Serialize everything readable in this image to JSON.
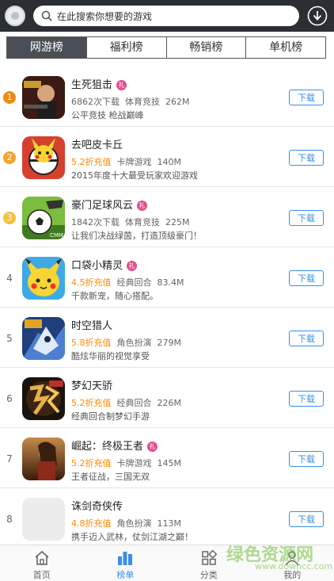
{
  "search": {
    "placeholder": "在此搜索你想要的游戏"
  },
  "tabs": [
    "网游榜",
    "福利榜",
    "畅销榜",
    "单机榜"
  ],
  "colors": {
    "rank1": "#f08a17",
    "rank2": "#f5a32a",
    "rank3": "#f5c23a",
    "accent": "#3a8ee6",
    "discount": "#ff8a00"
  },
  "items": [
    {
      "rank": "1",
      "name": "生死狙击",
      "gift": "礼",
      "meta_a": "6862次下载",
      "meta_b": "体育竞技",
      "size": "262M",
      "desc": "公平竞技 枪战巅峰",
      "download": "下载",
      "icon": "sniper-game-icon"
    },
    {
      "rank": "2",
      "name": "去吧皮卡丘",
      "gift": "",
      "meta_a": "5.2折充值",
      "meta_b": "卡牌游戏",
      "size": "140M",
      "desc": "2015年度十大最受玩家欢迎游戏",
      "download": "下载",
      "icon": "pikachu-game-icon"
    },
    {
      "rank": "3",
      "name": "豪门足球风云",
      "gift": "礼",
      "meta_a": "1842次下载",
      "meta_b": "体育竞技",
      "size": "225M",
      "desc": "让我们决战绿茵，打造顶级豪门！",
      "download": "下载",
      "icon": "football-game-icon"
    },
    {
      "rank": "4",
      "name": "口袋小精灵",
      "gift": "礼",
      "meta_a": "4.5折充值",
      "meta_b": "经典回合",
      "size": "83.4M",
      "desc": "千款新宠，随心搭配。",
      "download": "下载",
      "icon": "pocket-elf-game-icon"
    },
    {
      "rank": "5",
      "name": "时空猎人",
      "gift": "",
      "meta_a": "5.8折充值",
      "meta_b": "角色扮演",
      "size": "279M",
      "desc": "酷炫华丽的视觉享受",
      "download": "下载",
      "icon": "time-hunter-game-icon"
    },
    {
      "rank": "6",
      "name": "梦幻天骄",
      "gift": "",
      "meta_a": "5.2折充值",
      "meta_b": "经典回合",
      "size": "226M",
      "desc": "经典回合制梦幻手游",
      "download": "下载",
      "icon": "dream-game-icon"
    },
    {
      "rank": "7",
      "name": "崛起：终极王者",
      "gift": "礼",
      "meta_a": "5.2折充值",
      "meta_b": "卡牌游戏",
      "size": "145M",
      "desc": "王者征战，三国无双",
      "download": "下载",
      "icon": "rise-king-game-icon"
    },
    {
      "rank": "8",
      "name": "诛剑奇侠传",
      "gift": "",
      "meta_a": "4.8折充值",
      "meta_b": "角色扮演",
      "size": "113M",
      "desc": "携手迈入武林，仗剑江湖之巅！",
      "download": "下载",
      "icon": "sword-game-icon"
    }
  ],
  "bottom_nav": [
    {
      "label": "首页",
      "icon": "home-icon"
    },
    {
      "label": "榜单",
      "icon": "ranking-icon"
    },
    {
      "label": "分类",
      "icon": "category-icon"
    },
    {
      "label": "我的",
      "icon": "profile-icon"
    }
  ],
  "watermark": {
    "main": "绿色资源网",
    "sub": "www.downcc.com"
  }
}
